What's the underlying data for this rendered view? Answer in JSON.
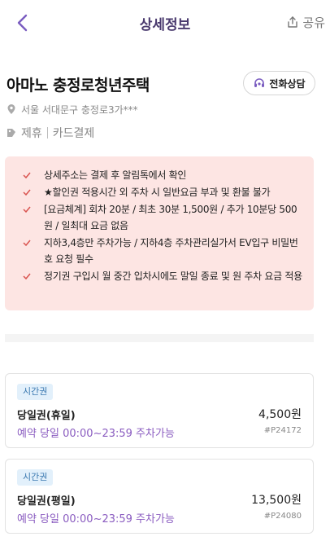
{
  "header": {
    "title": "상세정보",
    "share_label": "공유"
  },
  "place": {
    "title": "아마노 충정로청년주택",
    "call_label": "전화상담",
    "address": "서울 서대문구 충정로3가***",
    "tags": [
      "제휴",
      "카드결제"
    ]
  },
  "notice": {
    "items": [
      "상세주소는 결제 후 알림톡에서 확인",
      "★할인권 적용시간 외 주차 시 일반요금 부과 및 환불 불가",
      "[요금체계] 회차 20분 / 최초 30분 1,500원 / 추가 10분당 500원 / 일최대 요금 없음",
      "지하3,4층만 주차가능 / 지하4층 주차관리실가서 EV입구 비밀번호 요청 필수",
      "정기권 구입시 월 중간 입차시에도 말일 종료 및 원 주차 요금 적용"
    ]
  },
  "tickets": [
    {
      "badge": "시간권",
      "name": "당일권(휴일)",
      "price": "4,500원",
      "time": "예약 당일 00:00~23:59 주차가능",
      "code": "#P24172"
    },
    {
      "badge": "시간권",
      "name": "당일권(평일)",
      "price": "13,500원",
      "time": "예약 당일 00:00~23:59 주차가능",
      "code": "#P24080"
    }
  ],
  "colors": {
    "accent": "#8a5cc0",
    "header_title": "#4a3a6e",
    "notice_bg": "#fde5e3",
    "notice_check": "#d9534f",
    "badge_bg": "#e2f0fb",
    "badge_text": "#3a78b0"
  }
}
